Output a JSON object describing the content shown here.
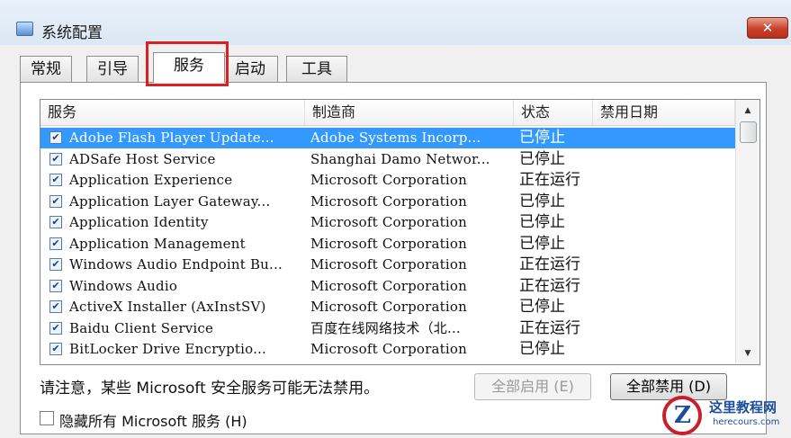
{
  "window": {
    "title": "系统配置",
    "close_label": "✕"
  },
  "tabs": [
    {
      "label": "常规"
    },
    {
      "label": "引导"
    },
    {
      "label": "服务"
    },
    {
      "label": "启动"
    },
    {
      "label": "工具"
    }
  ],
  "active_tab": "服务",
  "table": {
    "columns": [
      "服务",
      "制造商",
      "状态",
      "禁用日期"
    ],
    "rows": [
      {
        "service": "Adobe Flash Player Update...",
        "maker": "Adobe Systems Incorp...",
        "status": "已停止",
        "checked": true
      },
      {
        "service": "ADSafe Host Service",
        "maker": "Shanghai Damo Networ...",
        "status": "已停止",
        "checked": true
      },
      {
        "service": "Application Experience",
        "maker": "Microsoft Corporation",
        "status": "正在运行",
        "checked": true
      },
      {
        "service": "Application Layer Gateway...",
        "maker": "Microsoft Corporation",
        "status": "已停止",
        "checked": true
      },
      {
        "service": "Application Identity",
        "maker": "Microsoft Corporation",
        "status": "已停止",
        "checked": true
      },
      {
        "service": "Application Management",
        "maker": "Microsoft Corporation",
        "status": "已停止",
        "checked": true
      },
      {
        "service": "Windows Audio Endpoint Bu...",
        "maker": "Microsoft Corporation",
        "status": "正在运行",
        "checked": true
      },
      {
        "service": "Windows Audio",
        "maker": "Microsoft Corporation",
        "status": "正在运行",
        "checked": true
      },
      {
        "service": "ActiveX Installer (AxInstSV)",
        "maker": "Microsoft Corporation",
        "status": "已停止",
        "checked": true
      },
      {
        "service": "Baidu Client Service",
        "maker": "百度在线网络技术（北...",
        "status": "正在运行",
        "checked": true
      },
      {
        "service": "BitLocker Drive Encryptio...",
        "maker": "Microsoft Corporation",
        "status": "已停止",
        "checked": true
      }
    ]
  },
  "notice": "请注意，某些 Microsoft 安全服务可能无法禁用。",
  "buttons": {
    "enable_all": "全部启用 (E)",
    "disable_all": "全部禁用 (D)"
  },
  "hide_microsoft": {
    "label": "隐藏所有 Microsoft 服务 (H)",
    "checked": false
  },
  "watermark": {
    "cn": "这里教程网",
    "en": "herecours.com",
    "letter": "Z"
  },
  "colors": {
    "selection": "#3399ff",
    "highlight_border": "#e02020",
    "close_button": "#c8402a"
  }
}
